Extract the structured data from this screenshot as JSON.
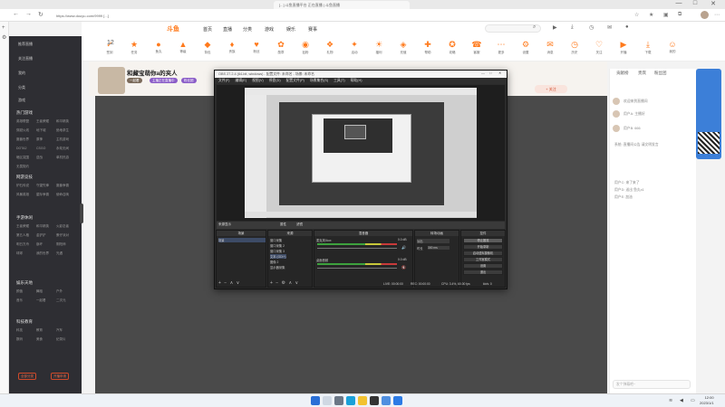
{
  "browser": {
    "tab_title": "[...] 斗鱼直播平台 正在直播 | 斗鱼直播",
    "url": "https://www.douyu.com/9999 [...]",
    "window_controls": [
      "—",
      "□",
      "✕"
    ],
    "nav_icons": [
      "back-icon",
      "forward-icon",
      "refresh-icon"
    ]
  },
  "site": {
    "logo": "斗鱼",
    "nav_links": [
      "首页",
      "直播",
      "分类",
      "游戏",
      "娱乐",
      "赛事",
      "鱼吧"
    ],
    "icon_count": "12",
    "icon_row": [
      "签到",
      "任务",
      "鱼丸",
      "等级",
      "背包",
      "贵族",
      "粉丝",
      "勋章",
      "钻粉",
      "礼物",
      "活动",
      "福利",
      "充值",
      "帮助",
      "攻略",
      "客服",
      "更多",
      "设置",
      "消息",
      "历史",
      "关注",
      "开播",
      "下载",
      "我的"
    ],
    "header_buttons": [
      "开播",
      "下载",
      "历史",
      "消息"
    ]
  },
  "sidebar": {
    "top_items": [
      "推荐直播",
      "关注直播",
      "我的",
      "分类",
      "游戏"
    ],
    "sections": [
      {
        "title": "热门游戏",
        "items": [
          "英雄联盟",
          "王者荣耀",
          "和平精英",
          "穿越火线",
          "地下城",
          "绝地求生",
          "魔兽世界",
          "原神",
          "主机游戏",
          "DOTA2",
          "CSGO",
          "永劫无间",
          "暗区突围",
          "逆战",
          "单机热游",
          "无畏契约"
        ]
      },
      {
        "title": "网游竞技",
        "items": [
          "炉石传说",
          "守望先锋",
          "魔兽争霸",
          "风暴英雄",
          "星际争霸",
          "使命召唤"
        ]
      },
      {
        "title": "手游休闲",
        "items": [
          "王者荣耀",
          "和平精英",
          "火影忍者",
          "第五人格",
          "金铲铲",
          "蛋仔派对",
          "明日方舟",
          "崩坏",
          "阴阳师",
          "球球",
          "我的世界",
          "光遇"
        ]
      },
      {
        "title": "娱乐天地",
        "items": [
          "颜值",
          "舞蹈",
          "户外",
          "音乐",
          "一起看",
          "二次元"
        ]
      },
      {
        "title": "科技教育",
        "items": [
          "科技",
          "教育",
          "汽车",
          "数码",
          "美食",
          "纪录片"
        ]
      }
    ],
    "bottom_buttons": [
      "全部分类",
      "开播申请"
    ]
  },
  "room": {
    "title": "和藏宝萌你a的夹人",
    "tags": [
      "一起看",
      "主播正在直播中",
      "粉丝团"
    ],
    "follow_label": "+ 关注"
  },
  "chat": {
    "tabs": [
      "贡献榜",
      "贵宾",
      "粉丝团"
    ],
    "messages": [
      "欢迎来到直播间",
      "用户A: 主播好",
      "用户B: 666",
      "系统: 直播间公告 请文明发言",
      "用户C: 来了来了",
      "用户D: 送出 鱼丸x1",
      "用户E: 加油"
    ],
    "input_placeholder": "发个弹幕吧~"
  },
  "obs": {
    "title": "OBS 27.2.4 (64-bit, windows) - 配置文件: 未命名 - 场景: 未命名",
    "menu": [
      "文件(F)",
      "编辑(E)",
      "视图(V)",
      "停靠(D)",
      "配置文件(P)",
      "场景集合(S)",
      "工具(T)",
      "帮助(H)"
    ],
    "strip_labels": [
      "来源显示",
      "属性",
      "滤镜"
    ],
    "scenes": {
      "header": "场景",
      "items": [
        "场景"
      ]
    },
    "sources": {
      "header": "来源",
      "items": [
        "窗口采集",
        "窗口采集 2",
        "窗口采集 3",
        "文本 (GDI+)",
        "图像 2",
        "显示器采集"
      ]
    },
    "mixer": {
      "header": "混音器",
      "channels": [
        {
          "name": "麦克风/Aux",
          "db": "0.0 dB"
        },
        {
          "name": "桌面音频",
          "db": "0.0 dB"
        }
      ]
    },
    "transitions": {
      "header": "转场动画",
      "type": "淡出",
      "duration_label": "时长",
      "duration": "300 ms"
    },
    "controls": {
      "header": "控件",
      "buttons": [
        "停止推流",
        "开始录制",
        "启动虚拟摄像机",
        "工作室模式",
        "设置",
        "退出"
      ]
    },
    "status": {
      "live": "LIVE: 00:00:00",
      "rec": "REC: 00:00:00",
      "cpu": "CPU: 3.4%, 60.00 fps",
      "bitrate": "kb/s: 0"
    }
  },
  "taskbar": {
    "time": "12:00",
    "date": "2023/1/1",
    "icons": [
      "start-icon",
      "search-icon",
      "taskview-icon",
      "edge-icon",
      "explorer-icon",
      "store-icon",
      "obs-icon",
      "mail-icon"
    ]
  }
}
